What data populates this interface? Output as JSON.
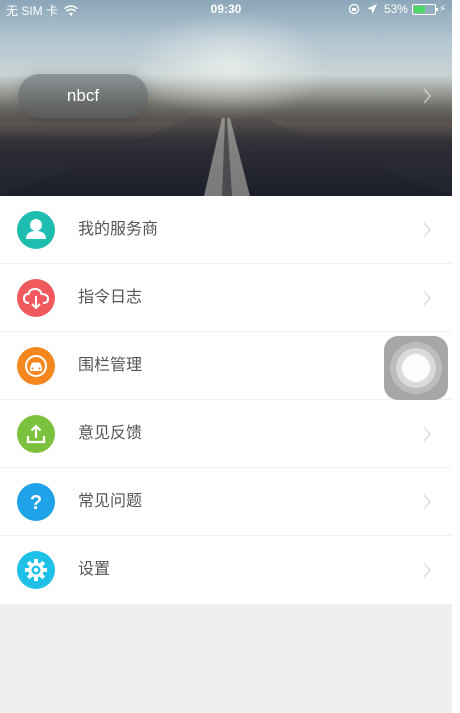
{
  "status_bar": {
    "carrier": "无 SIM 卡",
    "time": "09:30",
    "battery_text": "53%",
    "battery_level": 0.53,
    "battery_color": "#4cd964",
    "icons": [
      "wifi-icon",
      "orientation-lock-icon",
      "location-arrow-icon",
      "battery-icon",
      "charging-icon"
    ]
  },
  "profile": {
    "name": "nbcf"
  },
  "menu": {
    "items": [
      {
        "label": "我的服务商",
        "icon": "person-icon",
        "color": "#1fbcb0"
      },
      {
        "label": "指令日志",
        "icon": "cloud-download-icon",
        "color": "#f05a5e"
      },
      {
        "label": "围栏管理",
        "icon": "car-icon",
        "color": "#f5871f"
      },
      {
        "label": "意见反馈",
        "icon": "upload-icon",
        "color": "#7cc13e"
      },
      {
        "label": "常见问题",
        "icon": "question-icon",
        "color": "#1ea2e8"
      },
      {
        "label": "设置",
        "icon": "gear-icon",
        "color": "#1ec0e8"
      }
    ]
  }
}
